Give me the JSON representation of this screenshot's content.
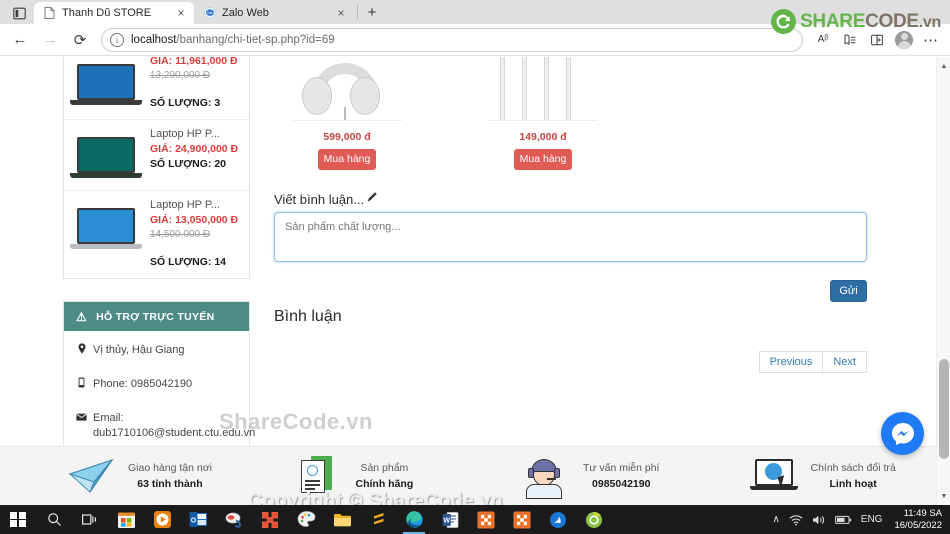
{
  "browser": {
    "tabs": [
      {
        "title": "Thanh Dũ STORE",
        "favicon": "page-icon",
        "active": true
      },
      {
        "title": "Zalo Web",
        "favicon": "zalo-icon",
        "active": false
      }
    ],
    "newtab_label": "+",
    "close_label": "×",
    "back_icon": "←",
    "forward_icon": "→",
    "reload_icon": "⟳",
    "url_scheme": "localhost",
    "url_path": "/banhang/chi-tiet-sp.php?id=69",
    "read_aloud_icon": "Aᵝ",
    "collections_icon": "collections-icon",
    "split_screen_icon": "split-screen-icon",
    "profile_icon": "profile-avatar",
    "settings_icon": "⋯"
  },
  "watermarks": {
    "logo_share": "SHARE",
    "logo_code": "CODE",
    "logo_vn": ".vn",
    "page_center": "ShareCode.vn",
    "copyright": "Copyright © ShareCode.vn"
  },
  "sidebar": {
    "products": [
      {
        "name": "",
        "price": "GIÁ: 11,961,000 Đ",
        "old_price": "13,290,000 Đ",
        "qty": "SỐ LƯỢNG: 3",
        "screen_color": "#1d6fb8",
        "body_color": "#3b3b3b"
      },
      {
        "name": "Laptop HP P...",
        "price": "GIÁ: 24,900,000 Đ",
        "old_price": "",
        "qty": "SỐ LƯỢNG: 20",
        "screen_color": "#0b6b63",
        "body_color": "#2f3d32"
      },
      {
        "name": "Laptop HP P...",
        "price": "GIÁ: 13,050,000 Đ",
        "old_price": "14,500,000 Đ",
        "qty": "SỐ LƯỢNG: 14",
        "screen_color": "#2b8fd6",
        "body_color": "#b9bcc0"
      }
    ],
    "support": {
      "title": "HỖ TRỢ TRỰC TUYẾN",
      "warning_icon": "⚠",
      "address_icon": "⚑",
      "address": "Vị thủy, Hậu Giang",
      "phone_icon": "☎",
      "phone": "Phone: 0985042190",
      "email_icon": "✉",
      "email_label": "Email:",
      "email": "dub1710106@student.ctu.edu.vn"
    }
  },
  "product_cards": [
    {
      "image": "headphones-image",
      "price": "599,000 đ",
      "buy_label": "Mua hàng"
    },
    {
      "image": "white-product-image",
      "price": "149,000 đ",
      "buy_label": "Mua hàng"
    }
  ],
  "comment_section": {
    "write_label": "Viết bình luận...",
    "pencil_icon": "✎",
    "textarea_placeholder": "Sản phẩm chất lượng...",
    "textarea_value": "",
    "send_label": "Gửi",
    "heading": "Bình luận",
    "previous_label": "Previous",
    "next_label": "Next"
  },
  "footer_services": [
    {
      "icon": "paper-plane-icon",
      "line1": "Giao hàng tận nơi",
      "line2": "63 tỉnh thành"
    },
    {
      "icon": "certificate-icon",
      "line1": "Sản phẩm",
      "line2": "Chính hãng"
    },
    {
      "icon": "headset-agent-icon",
      "line1": "Tư vấn miễn phí",
      "line2": "0985042190"
    },
    {
      "icon": "laptop-support-icon",
      "line1": "Chính sách đổi trả",
      "line2": "Linh hoạt"
    }
  ],
  "messenger": {
    "icon": "messenger-icon"
  },
  "taskbar": {
    "start_icon": "windows-start-icon",
    "items": [
      {
        "icon": "search-icon"
      },
      {
        "icon": "task-view-icon"
      },
      {
        "icon": "microsoft-store-icon"
      },
      {
        "icon": "media-player-icon"
      },
      {
        "icon": "outlook-icon"
      },
      {
        "icon": "paint-3d-icon"
      },
      {
        "icon": "xampp-icon"
      },
      {
        "icon": "paint-icon"
      },
      {
        "icon": "file-explorer-icon"
      },
      {
        "icon": "sublime-text-icon"
      },
      {
        "icon": "microsoft-edge-icon"
      },
      {
        "icon": "word-icon"
      },
      {
        "icon": "heidisql-icon"
      },
      {
        "icon": "heidisql-icon-2"
      },
      {
        "icon": "photos-icon"
      },
      {
        "icon": "chrome-canary-icon"
      }
    ],
    "tray": {
      "chevron_icon": "∧",
      "wifi_icon": "wifi-icon",
      "volume_icon": "🔊",
      "battery_icon": "battery-icon",
      "language": "ENG",
      "time": "11:49 SA",
      "date": "16/05/2022"
    }
  }
}
